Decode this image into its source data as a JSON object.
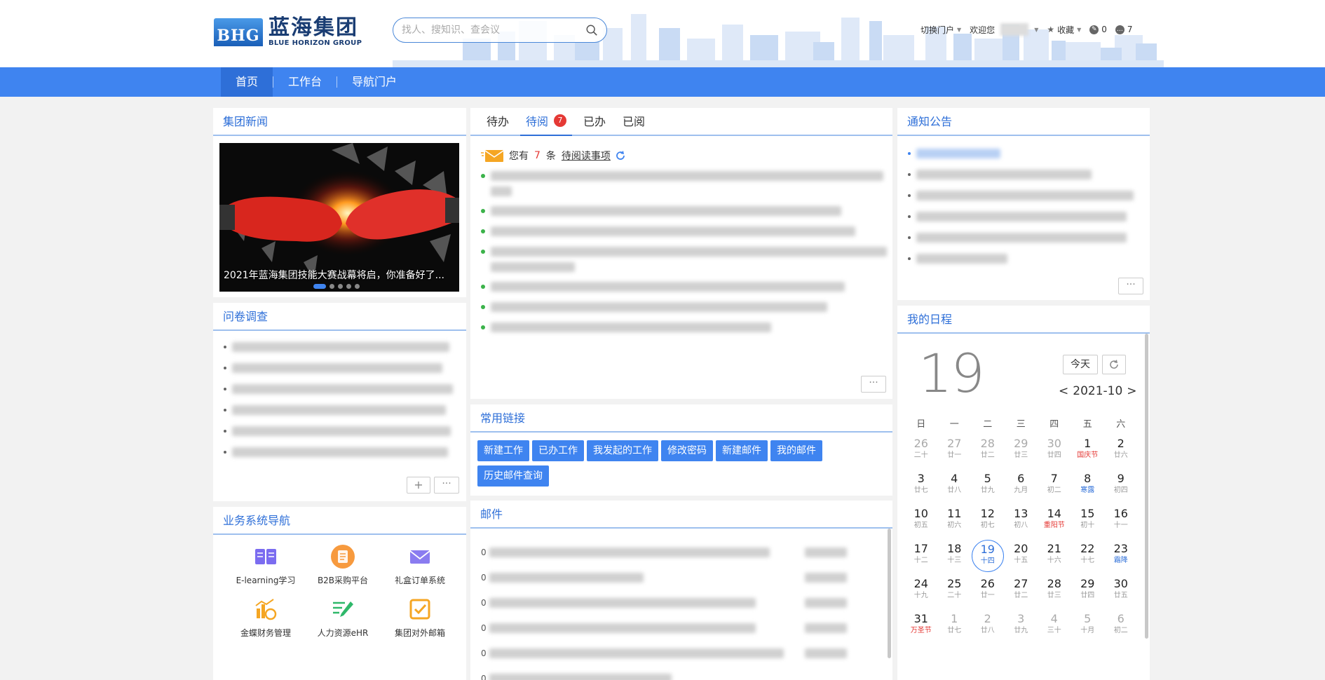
{
  "header": {
    "logo_mark": "BHG",
    "logo_cn": "蓝海集团",
    "logo_en": "BLUE HORIZON GROUP",
    "search_placeholder": "找人、搜知识、查会议",
    "switch_portal": "切换门户",
    "welcome": "欢迎您",
    "favorites": "收藏",
    "count_a": "0",
    "count_b": "7"
  },
  "nav": {
    "items": [
      {
        "label": "首页"
      },
      {
        "label": "工作台"
      },
      {
        "label": "导航门户"
      }
    ]
  },
  "news": {
    "title": "集团新闻",
    "caption": "2021年蓝海集团技能大赛战幕将启，你准备好了..."
  },
  "survey": {
    "title": "问卷调查"
  },
  "business": {
    "title": "业务系统导航",
    "apps": [
      {
        "label": "E-learning学习",
        "icon": "book-icon"
      },
      {
        "label": "B2B采购平台",
        "icon": "document-icon"
      },
      {
        "label": "礼盒订单系统",
        "icon": "mail-icon"
      },
      {
        "label": "金蝶财务管理",
        "icon": "chart-icon"
      },
      {
        "label": "人力资源eHR",
        "icon": "edit-list-icon"
      },
      {
        "label": "集团对外邮箱",
        "icon": "checkbox-icon"
      }
    ]
  },
  "todo": {
    "tabs": [
      {
        "label": "待办"
      },
      {
        "label": "待阅"
      },
      {
        "label": "已办"
      },
      {
        "label": "已阅"
      }
    ],
    "badge": "7",
    "you_have": "您有",
    "count": "7",
    "unit": "条",
    "link": "待阅读事项"
  },
  "links": {
    "title": "常用链接",
    "items": [
      {
        "label": "新建工作"
      },
      {
        "label": "已办工作"
      },
      {
        "label": "我发起的工作"
      },
      {
        "label": "修改密码"
      },
      {
        "label": "新建邮件"
      },
      {
        "label": "我的邮件"
      },
      {
        "label": "历史邮件查询"
      }
    ]
  },
  "mail": {
    "title": "邮件",
    "row_marker": "0"
  },
  "notice": {
    "title": "通知公告"
  },
  "schedule": {
    "title": "我的日程",
    "big_day": "19",
    "today_btn": "今天",
    "prev": "<",
    "month": "2021-10",
    "next": ">",
    "weekdays": [
      "日",
      "一",
      "二",
      "三",
      "四",
      "五",
      "六"
    ],
    "days": [
      {
        "d": "26",
        "l": "二十",
        "o": true
      },
      {
        "d": "27",
        "l": "廿一",
        "o": true
      },
      {
        "d": "28",
        "l": "廿二",
        "o": true
      },
      {
        "d": "29",
        "l": "廿三",
        "o": true
      },
      {
        "d": "30",
        "l": "廿四",
        "o": true
      },
      {
        "d": "1",
        "l": "国庆节",
        "c": "red"
      },
      {
        "d": "2",
        "l": "廿六"
      },
      {
        "d": "3",
        "l": "廿七"
      },
      {
        "d": "4",
        "l": "廿八"
      },
      {
        "d": "5",
        "l": "廿九"
      },
      {
        "d": "6",
        "l": "九月"
      },
      {
        "d": "7",
        "l": "初二"
      },
      {
        "d": "8",
        "l": "寒露",
        "c": "blue"
      },
      {
        "d": "9",
        "l": "初四"
      },
      {
        "d": "10",
        "l": "初五"
      },
      {
        "d": "11",
        "l": "初六"
      },
      {
        "d": "12",
        "l": "初七"
      },
      {
        "d": "13",
        "l": "初八"
      },
      {
        "d": "14",
        "l": "重阳节",
        "c": "red"
      },
      {
        "d": "15",
        "l": "初十"
      },
      {
        "d": "16",
        "l": "十一"
      },
      {
        "d": "17",
        "l": "十二"
      },
      {
        "d": "18",
        "l": "十三"
      },
      {
        "d": "19",
        "l": "十四",
        "t": true
      },
      {
        "d": "20",
        "l": "十五"
      },
      {
        "d": "21",
        "l": "十六"
      },
      {
        "d": "22",
        "l": "十七"
      },
      {
        "d": "23",
        "l": "霜降",
        "c": "blue"
      },
      {
        "d": "24",
        "l": "十九"
      },
      {
        "d": "25",
        "l": "二十"
      },
      {
        "d": "26",
        "l": "廿一"
      },
      {
        "d": "27",
        "l": "廿二"
      },
      {
        "d": "28",
        "l": "廿三"
      },
      {
        "d": "29",
        "l": "廿四"
      },
      {
        "d": "30",
        "l": "廿五"
      },
      {
        "d": "31",
        "l": "万圣节",
        "c": "red"
      },
      {
        "d": "1",
        "l": "廿七",
        "o": true
      },
      {
        "d": "2",
        "l": "廿八",
        "o": true
      },
      {
        "d": "3",
        "l": "廿九",
        "o": true
      },
      {
        "d": "4",
        "l": "三十",
        "o": true
      },
      {
        "d": "5",
        "l": "十月",
        "o": true
      },
      {
        "d": "6",
        "l": "初二",
        "o": true
      }
    ]
  },
  "colors": {
    "primary": "#3f84f0",
    "nav_active": "#2e6fd8",
    "badge": "#e53935"
  }
}
